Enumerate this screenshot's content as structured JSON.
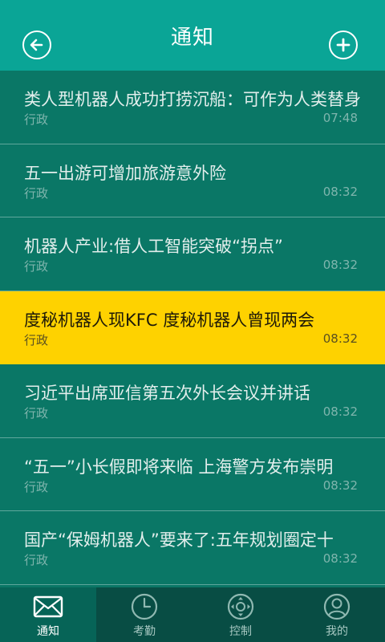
{
  "header": {
    "title": "通知",
    "back_icon": "back-arrow-icon",
    "add_icon": "plus-icon"
  },
  "list": {
    "items": [
      {
        "title": "类人型机器人成功打捞沉船：可作为人类替身",
        "tag": "行政",
        "time": "07:48",
        "highlighted": false
      },
      {
        "title": "五一出游可增加旅游意外险",
        "tag": "行政",
        "time": "08:32",
        "highlighted": false
      },
      {
        "title": "机器人产业:借人工智能突破“拐点”",
        "tag": "行政",
        "time": "08:32",
        "highlighted": false
      },
      {
        "title": "度秘机器人现KFC 度秘机器人曾现两会",
        "tag": "行政",
        "time": "08:32",
        "highlighted": true
      },
      {
        "title": "习近平出席亚信第五次外长会议并讲话",
        "tag": "行政",
        "time": "08:32",
        "highlighted": false
      },
      {
        "title": "“五一”小长假即将来临 上海警方发布崇明",
        "tag": "行政",
        "time": "08:32",
        "highlighted": false
      },
      {
        "title": "国产“保姆机器人”要来了:五年规划圈定十",
        "tag": "行政",
        "time": "08:32",
        "highlighted": false
      }
    ]
  },
  "tabbar": {
    "tabs": [
      {
        "label": "通知",
        "icon": "envelope-icon",
        "active": true
      },
      {
        "label": "考勤",
        "icon": "clock-icon",
        "active": false
      },
      {
        "label": "控制",
        "icon": "dpad-icon",
        "active": false
      },
      {
        "label": "我的",
        "icon": "user-icon",
        "active": false
      }
    ]
  },
  "colors": {
    "header_bg": "#0aa596",
    "list_bg": "#0a7766",
    "highlight": "#fed200",
    "tabbar_bg": "#084d44"
  }
}
